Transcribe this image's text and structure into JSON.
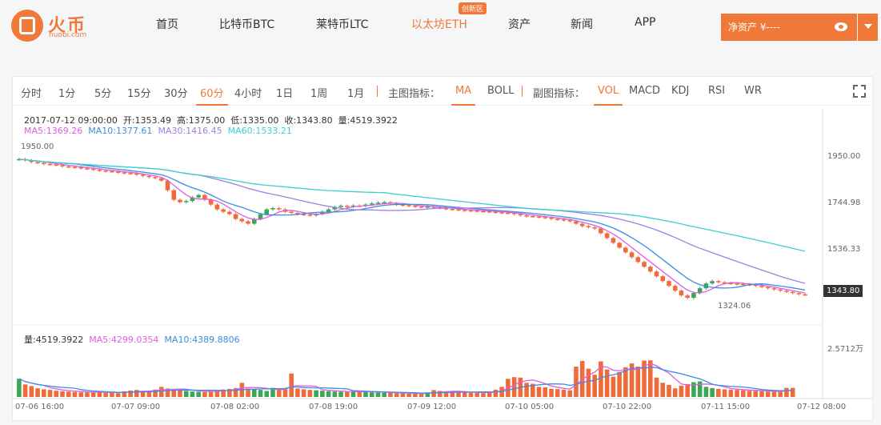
{
  "logo": {
    "name": "火币",
    "sub": "huobi.com"
  },
  "nav": [
    {
      "label": "首页",
      "active": false
    },
    {
      "label": "比特币BTC",
      "active": false
    },
    {
      "label": "莱特币LTC",
      "active": false
    },
    {
      "label": "以太坊ETH",
      "active": true
    },
    {
      "label": "资产",
      "active": false
    },
    {
      "label": "新闻",
      "active": false
    },
    {
      "label": "APP",
      "active": false
    }
  ],
  "nav_badge": "创新区",
  "asset_button": "净资产 ¥----",
  "toolbar": {
    "periods": [
      "分时",
      "1分",
      "5分",
      "15分",
      "30分",
      "60分",
      "4小时",
      "1日",
      "1周",
      "1月"
    ],
    "main_label": "主图指标：",
    "main_indicators": [
      "MA",
      "BOLL"
    ],
    "sub_label": "副图指标：",
    "sub_indicators": [
      "VOL",
      "MACD",
      "KDJ",
      "RSI",
      "WR"
    ]
  },
  "ohlc_line": {
    "datetime": "2017-07-12 09:00:00",
    "open": "开:1353.49",
    "high": "高:1375.00",
    "low": "低:1335.00",
    "close": "收:1343.80",
    "volume": "量:4519.3922"
  },
  "ma_line": {
    "ma5": "MA5:1369.26",
    "ma10": "MA10:1377.61",
    "ma30": "MA30:1416.45",
    "ma60": "MA60:1533.21"
  },
  "vol_line": {
    "vol": "量:4519.3922",
    "ma5": "MA5:4299.0354",
    "ma10": "MA10:4389.8806"
  },
  "price_axis": [
    "1950.00",
    "1744.98",
    "1536.33"
  ],
  "current_price": "1343.80",
  "vol_axis": "2.5712万",
  "time_axis": [
    "07-06 16:00",
    "07-07 09:00",
    "07-08 02:00",
    "07-08 19:00",
    "07-09 12:00",
    "07-10 05:00",
    "07-10 22:00",
    "07-11 15:00",
    "07-12 08:00"
  ],
  "high_marker": "1950.00",
  "low_marker": "1324.06",
  "colors": {
    "accent": "#f07838",
    "up": "#3aa757",
    "down": "#f06b3a",
    "ma5": "#e05ce0",
    "ma10": "#3a8de0",
    "ma30": "#a07ee0",
    "ma60": "#3ad0d0"
  },
  "chart_data": {
    "type": "candlestick",
    "price_range": [
      1250,
      2020
    ],
    "volume_range": [
      0,
      25712
    ],
    "close": [
      1910,
      1905,
      1898,
      1895,
      1890,
      1888,
      1885,
      1880,
      1878,
      1876,
      1872,
      1870,
      1866,
      1862,
      1860,
      1858,
      1855,
      1852,
      1850,
      1845,
      1840,
      1835,
      1830,
      1820,
      1780,
      1740,
      1730,
      1735,
      1750,
      1760,
      1740,
      1720,
      1700,
      1690,
      1680,
      1660,
      1650,
      1640,
      1660,
      1680,
      1700,
      1705,
      1700,
      1690,
      1685,
      1680,
      1678,
      1675,
      1680,
      1690,
      1700,
      1710,
      1715,
      1712,
      1716,
      1714,
      1720,
      1725,
      1728,
      1730,
      1725,
      1720,
      1718,
      1715,
      1712,
      1710,
      1712,
      1708,
      1705,
      1702,
      1700,
      1698,
      1696,
      1695,
      1693,
      1692,
      1690,
      1688,
      1686,
      1685,
      1680,
      1675,
      1672,
      1670,
      1668,
      1665,
      1660,
      1658,
      1655,
      1650,
      1640,
      1630,
      1625,
      1620,
      1600,
      1580,
      1560,
      1540,
      1520,
      1500,
      1480,
      1460,
      1440,
      1420,
      1400,
      1380,
      1360,
      1340,
      1330,
      1350,
      1370,
      1390,
      1400,
      1395,
      1392,
      1390,
      1388,
      1386,
      1385,
      1380,
      1375,
      1370,
      1365,
      1360,
      1355,
      1350,
      1345,
      1343.8
    ],
    "volume": [
      9000,
      6200,
      5400,
      4300,
      3800,
      3500,
      3100,
      2800,
      2700,
      2500,
      2300,
      2200,
      2400,
      2600,
      2100,
      2000,
      1900,
      2800,
      3200,
      3500,
      2800,
      2500,
      3600,
      5000,
      4200,
      3600,
      3400,
      3000,
      2700,
      2600,
      2500,
      3000,
      3300,
      3700,
      4000,
      4400,
      7000,
      4200,
      3800,
      3500,
      3000,
      4500,
      3600,
      4000,
      11600,
      4200,
      3800,
      3500,
      3300,
      3100,
      2900,
      2700,
      2600,
      2500,
      2700,
      2800,
      2400,
      2300,
      2200,
      2100,
      2000,
      1900,
      1800,
      1700,
      1600,
      1500,
      2300,
      3400,
      3000,
      2800,
      2600,
      2500,
      2300,
      2100,
      2000,
      1900,
      2600,
      3600,
      5000,
      9000,
      9800,
      9600,
      7000,
      6500,
      5000,
      4800,
      4000,
      3900,
      3600,
      3300,
      15000,
      17800,
      14000,
      11000,
      17600,
      13600,
      10000,
      12300,
      14700,
      16600,
      15000,
      18000,
      18100,
      9600,
      7000,
      6000,
      4300,
      5600,
      6400,
      7300,
      7700,
      5000,
      4400,
      4000,
      3800,
      3600,
      3500,
      3300,
      3100,
      3000,
      2900,
      2700,
      2600,
      2500,
      4500,
      4519
    ]
  }
}
